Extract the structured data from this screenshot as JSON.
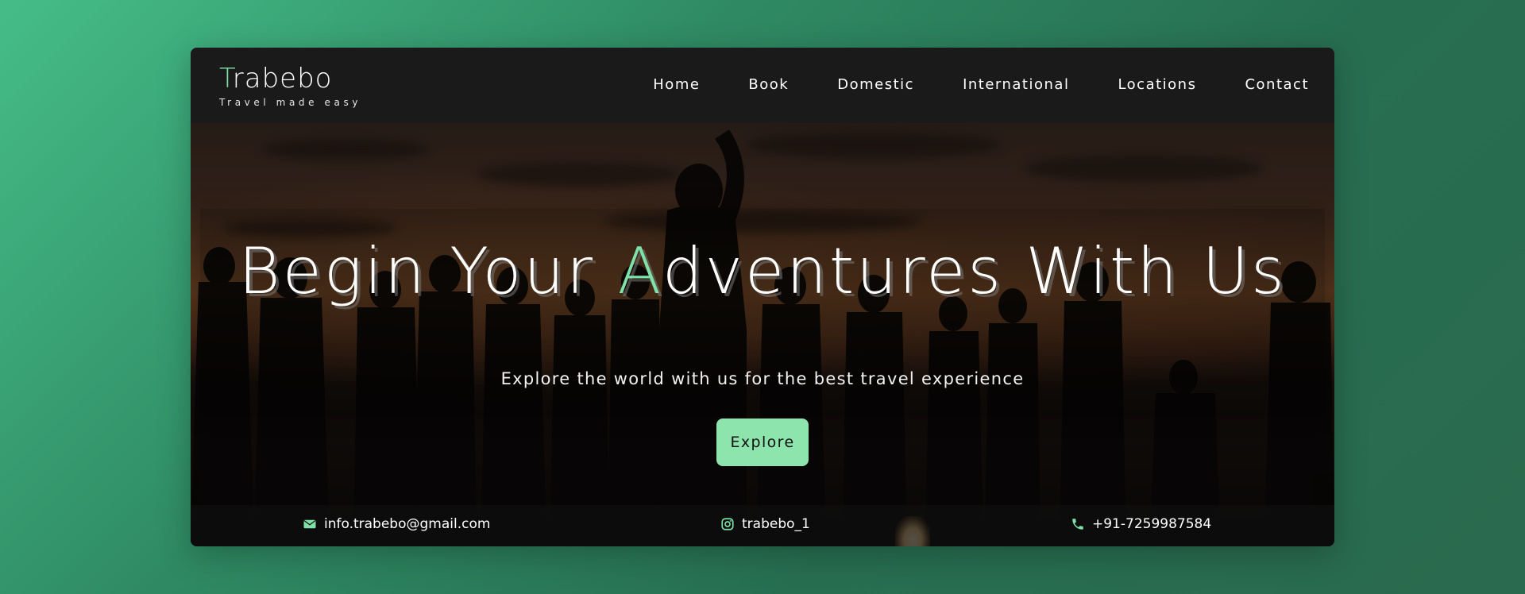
{
  "brand": {
    "accent_letter": "T",
    "name_rest": "rabebo",
    "tagline": "Travel made easy"
  },
  "nav": {
    "items": [
      {
        "label": "Home"
      },
      {
        "label": "Book"
      },
      {
        "label": "Domestic"
      },
      {
        "label": "International"
      },
      {
        "label": "Locations"
      },
      {
        "label": "Contact"
      }
    ]
  },
  "hero": {
    "title_before": "Begin Your ",
    "title_accent": "A",
    "title_after": "dventures With Us",
    "subtitle": "Explore the world with us for the best travel experience",
    "cta_label": "Explore"
  },
  "contact": {
    "email": "info.trabebo@gmail.com",
    "instagram": "trabebo_1",
    "phone": "+91-7259987584"
  },
  "colors": {
    "accent": "#7ee2a8",
    "button_bg": "#8ee4ad",
    "navbar_bg": "#1a1a1a",
    "page_gradient_start": "#45bd88",
    "page_gradient_end": "#2a6a4e"
  },
  "icons": {
    "email": "envelope-icon",
    "instagram": "instagram-icon",
    "phone": "phone-icon"
  }
}
